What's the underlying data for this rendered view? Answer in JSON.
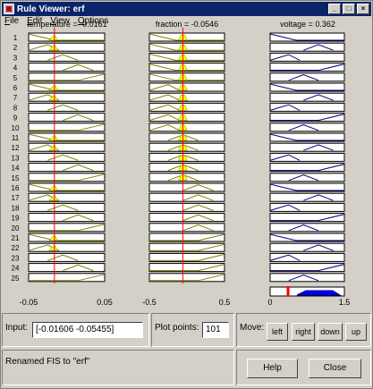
{
  "window": {
    "title": "Rule Viewer: erf",
    "minimize": "_",
    "maximize": "□",
    "close": "×"
  },
  "menu": [
    {
      "label": "File",
      "key": "F",
      "rest": "ile"
    },
    {
      "label": "Edit",
      "key": "E",
      "rest": "dit"
    },
    {
      "label": "View",
      "key": "V",
      "rest": "iew"
    },
    {
      "label": "Options",
      "key": "O",
      "rest": "ptions"
    }
  ],
  "headers": {
    "input1": "temperature = -0.0161",
    "input2": "fraction = -0.0546",
    "output": "voltage = 0.362"
  },
  "rule_numbers": [
    "1",
    "2",
    "3",
    "4",
    "5",
    "6",
    "7",
    "8",
    "9",
    "10",
    "11",
    "12",
    "13",
    "14",
    "15",
    "16",
    "17",
    "18",
    "19",
    "20",
    "21",
    "22",
    "23",
    "24",
    "25"
  ],
  "axes": {
    "input1": {
      "min": -0.05,
      "max": 0.05,
      "min_label": "-0.05",
      "max_label": "0.05",
      "value": -0.01606
    },
    "input2": {
      "min": -0.5,
      "max": 0.5,
      "min_label": "-0.5",
      "max_label": "0.5",
      "value": -0.05455
    },
    "output": {
      "min": 0,
      "max": 1.5,
      "min_label": "0",
      "max_label": "1.5",
      "value": 0.362
    }
  },
  "input_panel": {
    "label": "Input:",
    "value": "[-0.01606 -0.05455]"
  },
  "plot_points": {
    "label": "Plot points:",
    "value": "101"
  },
  "move": {
    "label": "Move:",
    "left": "left",
    "right": "right",
    "down": "down",
    "up": "up"
  },
  "status": {
    "text": "Renamed FIS to \"erf\""
  },
  "buttons": {
    "help": "Help",
    "close": "Close"
  },
  "colors": {
    "input_mf": "#808000",
    "input_fill": "#ffff00",
    "output_mf": "#000080",
    "output_fill": "#0000ff",
    "cursor": "#ff0000",
    "titlebar": "#0a246a"
  }
}
